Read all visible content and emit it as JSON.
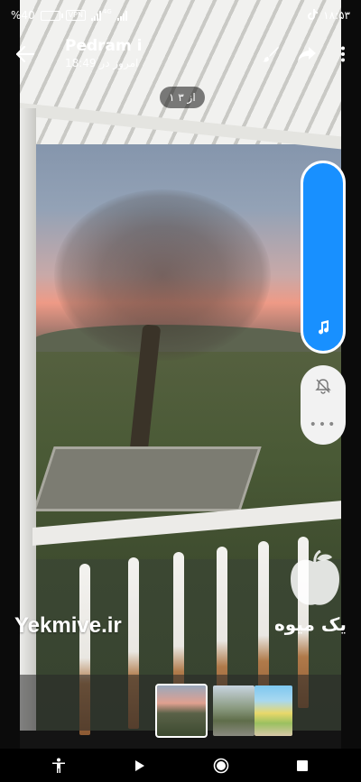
{
  "status_bar": {
    "battery_text": "%40",
    "battery_level": 0.4,
    "vpn_label": "VPN",
    "network_label": "4G",
    "clock": "۱۸:۵۳",
    "icons": [
      "battery-icon",
      "vpn-icon",
      "signal-icon",
      "tiktok-icon"
    ]
  },
  "header": {
    "back_icon": "arrow-left-icon",
    "sender_name": "Pedram i",
    "timestamp": "امروز در 18:49",
    "actions": [
      "brush-icon",
      "share-icon",
      "more-vertical-icon"
    ]
  },
  "counter": {
    "text": "۱ از ۳"
  },
  "side_panel": {
    "music_icon": "music-note-icon",
    "mute_icon": "bell-off-icon",
    "more_icon": "more-horizontal-icon",
    "accent_color": "#1890ff"
  },
  "watermark": {
    "site": "Yekmive.ir",
    "brand_fa": "یک میوه"
  },
  "thumbnails": {
    "count": 3,
    "active_index": 0
  },
  "navbar": {
    "buttons": [
      "accessibility-icon",
      "play-icon",
      "home-icon",
      "square-icon"
    ]
  }
}
